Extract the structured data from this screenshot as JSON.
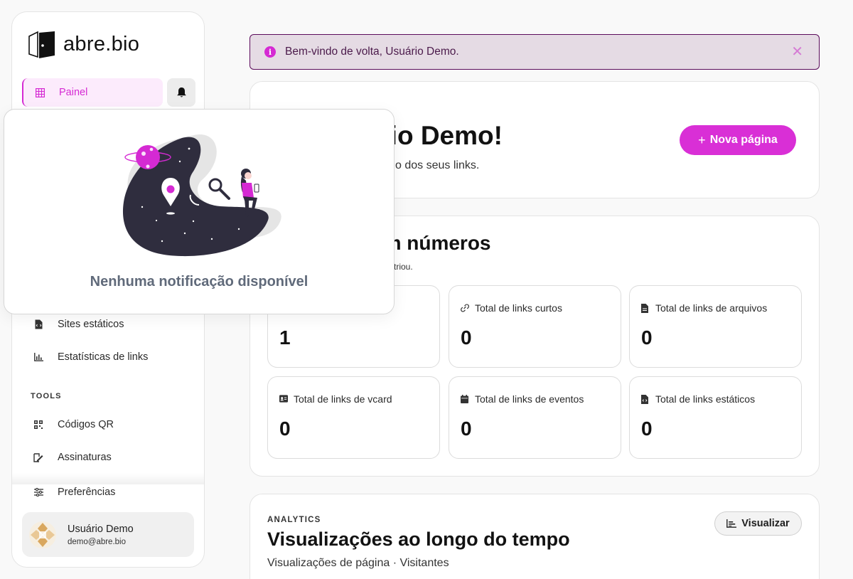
{
  "brand": {
    "name": "abre.bio",
    "accent": "#d92fd6"
  },
  "sidebar": {
    "items": [
      {
        "label": "Painel",
        "icon": "grid-icon",
        "active": true
      },
      {
        "label": "Sites estáticos",
        "icon": "file-code-icon"
      },
      {
        "label": "Estatísticas de links",
        "icon": "bar-chart-icon"
      }
    ],
    "tools_label": "TOOLS",
    "tools": [
      {
        "label": "Códigos QR",
        "icon": "qr-icon"
      },
      {
        "label": "Assinaturas",
        "icon": "signature-icon"
      }
    ],
    "preferences_label": "Preferências",
    "user": {
      "name": "Usuário Demo",
      "email": "demo@abre.bio"
    }
  },
  "notifications": {
    "empty_text": "Nenhuma notificação disponível"
  },
  "banner": {
    "message": "Bem-vindo de volta, Usuário Demo.",
    "close": "✕"
  },
  "welcome": {
    "title": "irio Demo!",
    "subtitle": "o dos seus links.",
    "new_page_button": "Nova página"
  },
  "stats": {
    "title": "em números",
    "subtitle": "triou.",
    "cards": [
      {
        "label": "",
        "value": "1",
        "icon": ""
      },
      {
        "label": "Total de links curtos",
        "value": "0",
        "icon": "link-icon"
      },
      {
        "label": "Total de links de arquivos",
        "value": "0",
        "icon": "file-icon"
      },
      {
        "label": "Total de links de vcard",
        "value": "0",
        "icon": "vcard-icon"
      },
      {
        "label": "Total de links de eventos",
        "value": "0",
        "icon": "calendar-icon"
      },
      {
        "label": "Total de links estáticos",
        "value": "0",
        "icon": "file-code-icon"
      }
    ]
  },
  "analytics": {
    "kicker": "ANALYTICS",
    "title": "Visualizações ao longo do tempo",
    "subtitle": "Visualizações de página · Visitantes",
    "button": "Visualizar"
  }
}
